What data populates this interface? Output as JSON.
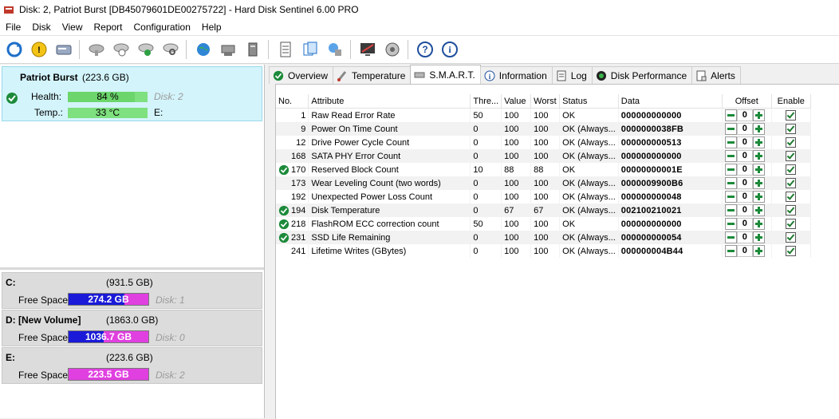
{
  "window": {
    "title": "Disk: 2, Patriot Burst [DB45079601DE00275722]  -  Hard Disk Sentinel 6.00 PRO"
  },
  "menu": [
    "File",
    "Disk",
    "View",
    "Report",
    "Configuration",
    "Help"
  ],
  "disk_card": {
    "name": "Patriot Burst",
    "size": "(223.6 GB)",
    "health_label": "Health:",
    "health_value": "84 %",
    "health_percent": 84,
    "temp_label": "Temp.:",
    "temp_value": "33 °C",
    "disk_ref": "Disk: 2",
    "drive_letter": "E:"
  },
  "volumes": [
    {
      "name": "C:",
      "size": "(931.5 GB)",
      "free_label": "Free Space",
      "free": "274.2 GB",
      "used_fraction": 0.7,
      "disk": "Disk: 1"
    },
    {
      "name": "D: [New Volume]",
      "size": "(1863.0 GB)",
      "free_label": "Free Space",
      "free": "1036.7 GB",
      "used_fraction": 0.44,
      "disk": "Disk: 0"
    },
    {
      "name": "E:",
      "size": "(223.6 GB)",
      "free_label": "Free Space",
      "free": "223.5 GB",
      "used_fraction": 0.0,
      "disk": "Disk: 2"
    }
  ],
  "tabs": [
    {
      "label": "Overview",
      "icon": "ok-icon"
    },
    {
      "label": "Temperature",
      "icon": "thermometer-icon"
    },
    {
      "label": "S.M.A.R.T.",
      "icon": "drive-icon",
      "active": true
    },
    {
      "label": "Information",
      "icon": "info-icon"
    },
    {
      "label": "Log",
      "icon": "log-icon"
    },
    {
      "label": "Disk Performance",
      "icon": "performance-icon"
    },
    {
      "label": "Alerts",
      "icon": "alerts-icon"
    }
  ],
  "smart": {
    "headers": {
      "no": "No.",
      "attribute": "Attribute",
      "threshold": "Thre...",
      "value": "Value",
      "worst": "Worst",
      "status": "Status",
      "data": "Data",
      "offset": "Offset",
      "enable": "Enable"
    },
    "rows": [
      {
        "no": "1",
        "attribute": "Raw Read Error Rate",
        "threshold": "50",
        "value": "100",
        "worst": "100",
        "status": "OK",
        "data": "000000000000",
        "offset": "0",
        "ok_icon": false
      },
      {
        "no": "9",
        "attribute": "Power On Time Count",
        "threshold": "0",
        "value": "100",
        "worst": "100",
        "status": "OK (Always...",
        "data": "0000000038FB",
        "offset": "0",
        "ok_icon": false
      },
      {
        "no": "12",
        "attribute": "Drive Power Cycle Count",
        "threshold": "0",
        "value": "100",
        "worst": "100",
        "status": "OK (Always...",
        "data": "000000000513",
        "offset": "0",
        "ok_icon": false
      },
      {
        "no": "168",
        "attribute": "SATA PHY Error Count",
        "threshold": "0",
        "value": "100",
        "worst": "100",
        "status": "OK (Always...",
        "data": "000000000000",
        "offset": "0",
        "ok_icon": false
      },
      {
        "no": "170",
        "attribute": "Reserved Block Count",
        "threshold": "10",
        "value": "88",
        "worst": "88",
        "status": "OK",
        "data": "00000000001E",
        "offset": "0",
        "ok_icon": true
      },
      {
        "no": "173",
        "attribute": "Wear Leveling Count (two words)",
        "threshold": "0",
        "value": "100",
        "worst": "100",
        "status": "OK (Always...",
        "data": "0000009900B6",
        "offset": "0",
        "ok_icon": false
      },
      {
        "no": "192",
        "attribute": "Unexpected Power Loss Count",
        "threshold": "0",
        "value": "100",
        "worst": "100",
        "status": "OK (Always...",
        "data": "000000000048",
        "offset": "0",
        "ok_icon": false
      },
      {
        "no": "194",
        "attribute": "Disk Temperature",
        "threshold": "0",
        "value": "67",
        "worst": "67",
        "status": "OK (Always...",
        "data": "002100210021",
        "offset": "0",
        "ok_icon": true
      },
      {
        "no": "218",
        "attribute": "FlashROM ECC correction count",
        "threshold": "50",
        "value": "100",
        "worst": "100",
        "status": "OK",
        "data": "000000000000",
        "offset": "0",
        "ok_icon": true
      },
      {
        "no": "231",
        "attribute": "SSD Life Remaining",
        "threshold": "0",
        "value": "100",
        "worst": "100",
        "status": "OK (Always...",
        "data": "000000000054",
        "offset": "0",
        "ok_icon": true
      },
      {
        "no": "241",
        "attribute": "Lifetime Writes (GBytes)",
        "threshold": "0",
        "value": "100",
        "worst": "100",
        "status": "OK (Always...",
        "data": "000000004B44",
        "offset": "0",
        "ok_icon": false
      }
    ]
  },
  "colors": {
    "selected_card": "#d3f4fb",
    "health_bar": "#7ee07e",
    "used_space": "#1a1ad8",
    "free_space": "#e040e0",
    "ok_green": "#1c8a3a"
  }
}
